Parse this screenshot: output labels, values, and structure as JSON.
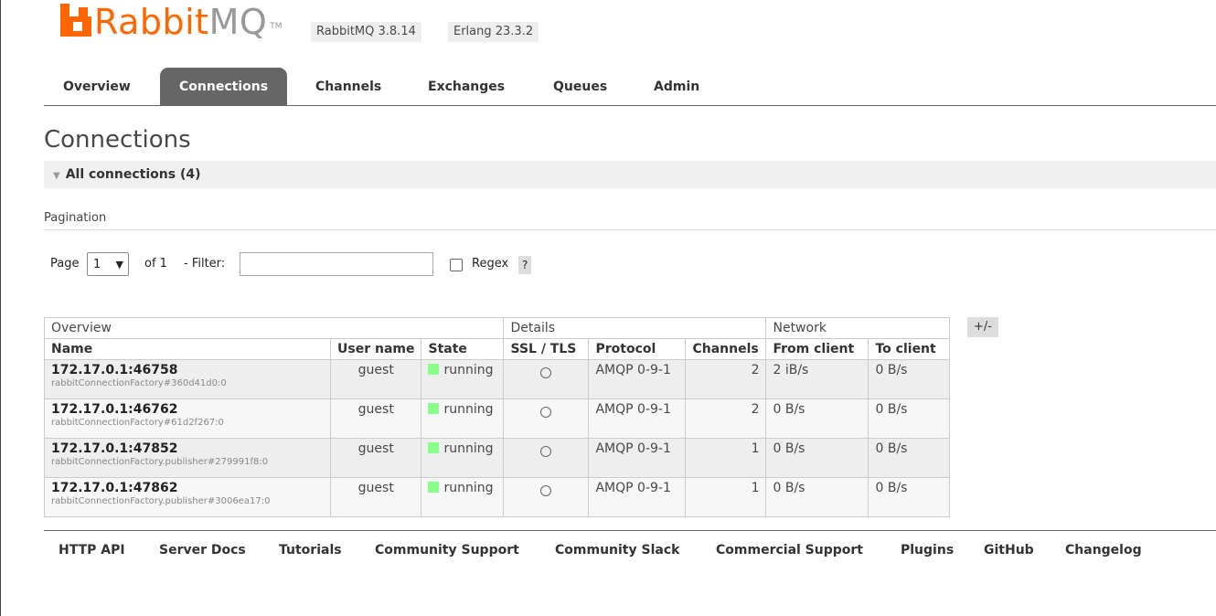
{
  "header": {
    "logo_text": "Rabbit",
    "logo_text_mq": "MQ",
    "logo_tm": "TM",
    "version_badge": "RabbitMQ 3.8.14",
    "erlang_badge": "Erlang 23.3.2"
  },
  "tabs": [
    "Overview",
    "Connections",
    "Channels",
    "Exchanges",
    "Queues",
    "Admin"
  ],
  "active_tab": "Connections",
  "page_title": "Connections",
  "section_title": "All connections (4)",
  "pagination": {
    "label": "Pagination",
    "page_label": "Page",
    "page_value": "1",
    "of_label": "of 1",
    "filter_label": "- Filter:",
    "filter_value": "",
    "regex_label": "Regex",
    "help_label": "?"
  },
  "table": {
    "groups": {
      "overview": "Overview",
      "details": "Details",
      "network": "Network",
      "toggle": "+/-"
    },
    "columns": [
      "Name",
      "User name",
      "State",
      "SSL / TLS",
      "Protocol",
      "Channels",
      "From client",
      "To client"
    ],
    "rows": [
      {
        "name": "172.17.0.1:46758",
        "sub": "rabbitConnectionFactory#360d41d0:0",
        "user": "guest",
        "state": "running",
        "protocol": "AMQP 0-9-1",
        "channels": "2",
        "from_client": "2 iB/s",
        "to_client": "0 B/s"
      },
      {
        "name": "172.17.0.1:46762",
        "sub": "rabbitConnectionFactory#61d2f267:0",
        "user": "guest",
        "state": "running",
        "protocol": "AMQP 0-9-1",
        "channels": "2",
        "from_client": "0 B/s",
        "to_client": "0 B/s"
      },
      {
        "name": "172.17.0.1:47852",
        "sub": "rabbitConnectionFactory.publisher#279991f8:0",
        "user": "guest",
        "state": "running",
        "protocol": "AMQP 0-9-1",
        "channels": "1",
        "from_client": "0 B/s",
        "to_client": "0 B/s"
      },
      {
        "name": "172.17.0.1:47862",
        "sub": "rabbitConnectionFactory.publisher#3006ea17:0",
        "user": "guest",
        "state": "running",
        "protocol": "AMQP 0-9-1",
        "channels": "1",
        "from_client": "0 B/s",
        "to_client": "0 B/s"
      }
    ]
  },
  "footer": [
    "HTTP API",
    "Server Docs",
    "Tutorials",
    "Community Support",
    "Community Slack",
    "Commercial Support",
    "Plugins",
    "GitHub",
    "Changelog"
  ],
  "colors": {
    "brand": "#ff6600",
    "running": "#88ff88",
    "tab_active": "#666666"
  }
}
